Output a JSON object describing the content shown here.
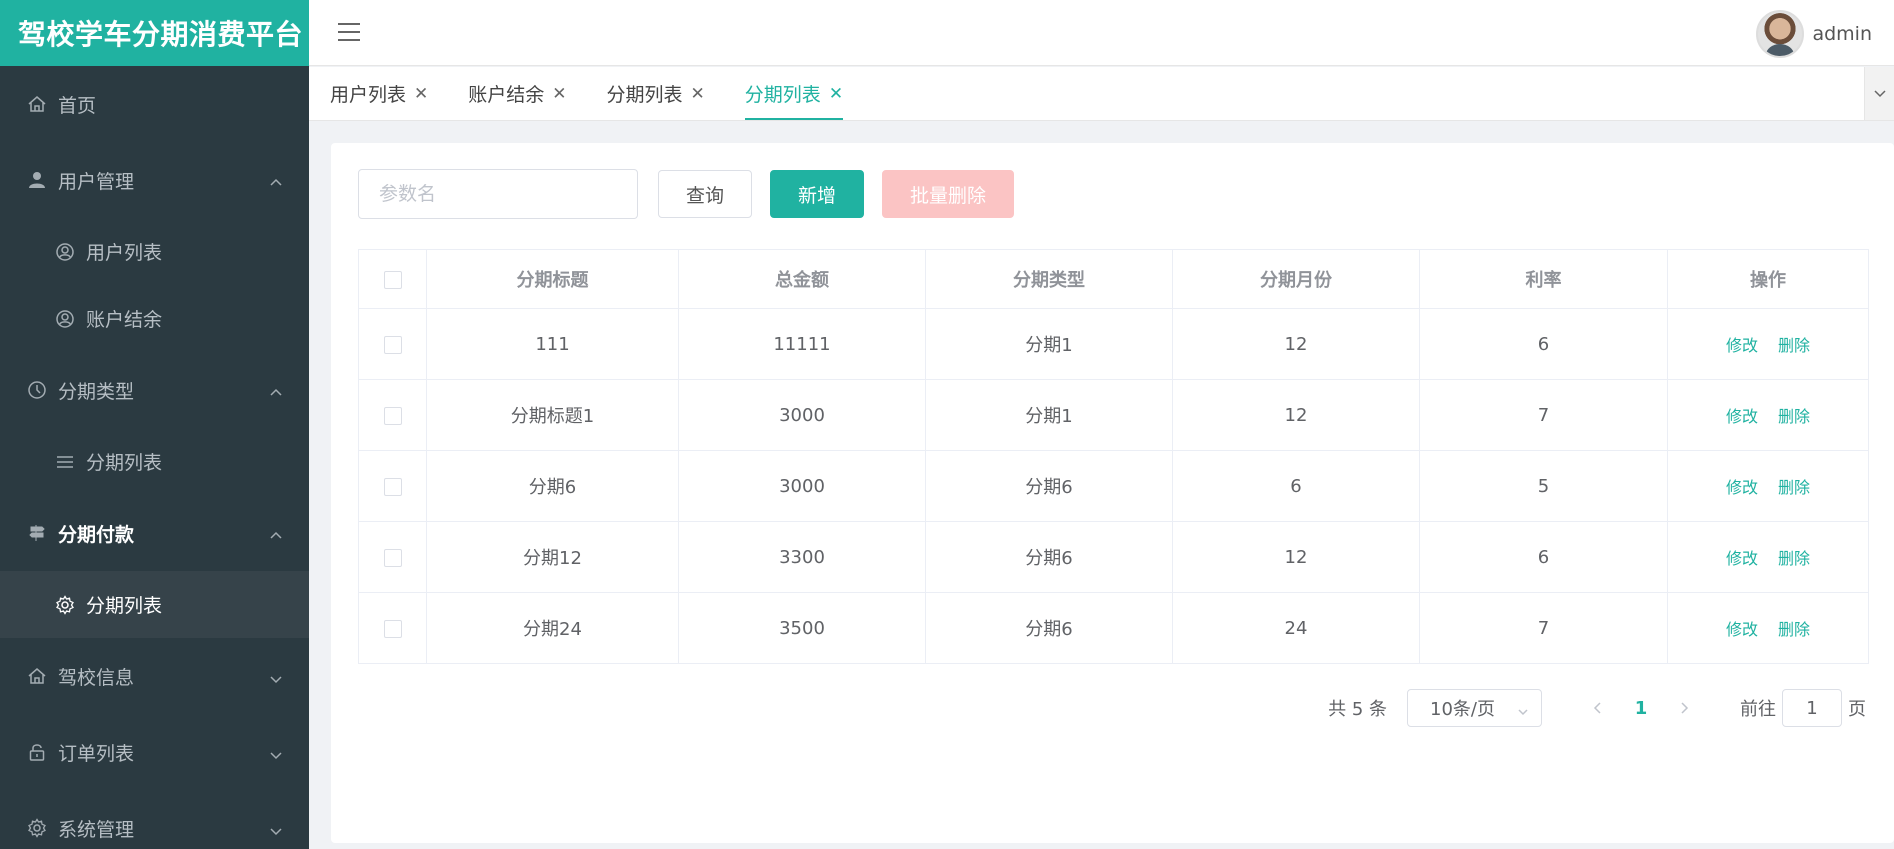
{
  "brand": {
    "title": "驾校学车分期消费平台"
  },
  "header": {
    "username": "admin"
  },
  "sidebar": {
    "items": [
      {
        "label": "首页",
        "icon": "home-icon",
        "type": "top"
      },
      {
        "label": "用户管理",
        "icon": "user-icon",
        "type": "group",
        "expanded": true
      },
      {
        "label": "用户列表",
        "icon": "user-circle-icon",
        "type": "sub"
      },
      {
        "label": "账户结余",
        "icon": "user-circle-icon",
        "type": "sub"
      },
      {
        "label": "分期类型",
        "icon": "clock-icon",
        "type": "group",
        "expanded": true
      },
      {
        "label": "分期列表",
        "icon": "list-icon",
        "type": "sub"
      },
      {
        "label": "分期付款",
        "icon": "signpost-icon",
        "type": "group",
        "expanded": true,
        "highlight": true
      },
      {
        "label": "分期列表",
        "icon": "gear-icon",
        "type": "sub",
        "active": true
      },
      {
        "label": "驾校信息",
        "icon": "home-icon",
        "type": "group",
        "expanded": false
      },
      {
        "label": "订单列表",
        "icon": "lock-icon",
        "type": "group",
        "expanded": false
      },
      {
        "label": "系统管理",
        "icon": "gear-icon",
        "type": "group",
        "expanded": false
      }
    ]
  },
  "tabs": [
    {
      "label": "用户列表",
      "active": false
    },
    {
      "label": "账户结余",
      "active": false
    },
    {
      "label": "分期列表",
      "active": false
    },
    {
      "label": "分期列表",
      "active": true
    }
  ],
  "toolbar": {
    "search_placeholder": "参数名",
    "search_value": "",
    "query_label": "查询",
    "add_label": "新增",
    "batch_delete_label": "批量删除"
  },
  "table": {
    "headers": [
      "分期标题",
      "总金额",
      "分期类型",
      "分期月份",
      "利率",
      "操作"
    ],
    "rows": [
      [
        "111",
        "11111",
        "分期1",
        "12",
        "6"
      ],
      [
        "分期标题1",
        "3000",
        "分期1",
        "12",
        "7"
      ],
      [
        "分期6",
        "3000",
        "分期6",
        "6",
        "5"
      ],
      [
        "分期12",
        "3300",
        "分期6",
        "12",
        "6"
      ],
      [
        "分期24",
        "3500",
        "分期6",
        "24",
        "7"
      ]
    ],
    "edit_label": "修改",
    "delete_label": "删除"
  },
  "pagination": {
    "total_text": "共 5 条",
    "page_size": "10条/页",
    "current_page": "1",
    "goto_label": "前往",
    "goto_value": "1",
    "page_unit": "页"
  },
  "colors": {
    "accent": "#20b2a1",
    "sidebar_bg": "#2b3a41",
    "danger_light": "#fbc4c4"
  }
}
